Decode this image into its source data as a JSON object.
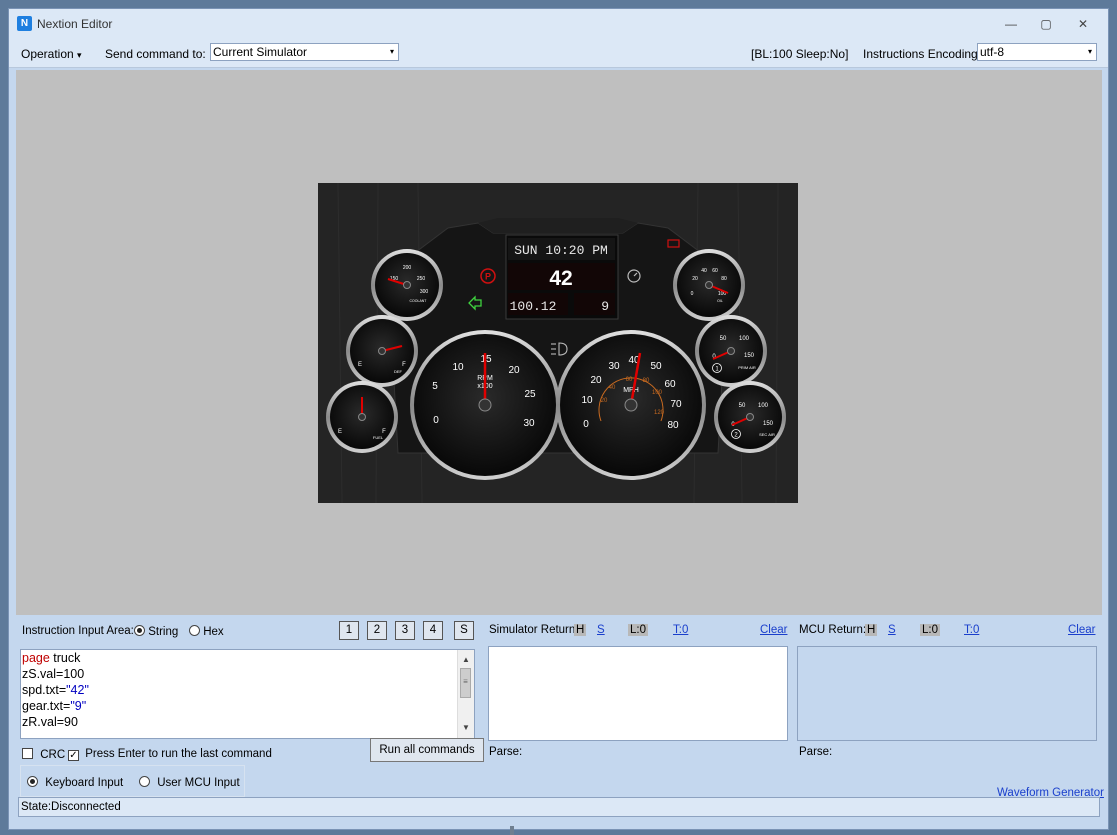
{
  "window": {
    "title": "Nextion Editor",
    "logo_icon": "nextion-logo-icon",
    "minimize_glyph": "—",
    "maximize_glyph": "▢",
    "close_glyph": "✕"
  },
  "toolbar": {
    "operation_label": "Operation",
    "operation_arrow": "▾",
    "send_label": "Send command to:",
    "send_value": "Current Simulator",
    "status_text": "[BL:100  Sleep:No]",
    "encoding_label": "Instructions Encoding:",
    "encoding_value": "utf-8",
    "combo_arrow": "▾"
  },
  "dash": {
    "datetime": "SUN 10:20 PM",
    "speed": "42",
    "odometer": "100.12",
    "gear": "9",
    "rpm_label": "RPM",
    "rpm_multiplier": "x100",
    "mph_label": "MPH",
    "rpm_ticks": [
      "0",
      "5",
      "10",
      "15",
      "20",
      "25",
      "30"
    ],
    "mph_ticks": [
      "0",
      "10",
      "20",
      "30",
      "40",
      "50",
      "60",
      "70",
      "80"
    ],
    "kmh_ticks": [
      "20",
      "40",
      "60",
      "80",
      "100",
      "120"
    ],
    "coolant_ticks": [
      "150",
      "200",
      "250",
      "300"
    ],
    "coolant_label": "COOLANT",
    "oil_ticks": [
      "20",
      "40",
      "60",
      "80",
      "100",
      "0"
    ],
    "oil_label": "OIL",
    "def_letters": [
      "E",
      "F"
    ],
    "def_label": "DEF",
    "prim_ticks": [
      "0",
      "50",
      "100",
      "150"
    ],
    "prim_label": "PRIM AIR",
    "fuel_letters": [
      "E",
      "F"
    ],
    "fuel_label": "FUEL",
    "sec_ticks": [
      "0",
      "50",
      "100",
      "150"
    ],
    "sec_label": "SEC AIR",
    "prim_badge": "1",
    "sec_badge": "2"
  },
  "instruction": {
    "area_label": "Instruction Input Area:",
    "mode_string": "String",
    "mode_hex": "Hex",
    "mode_selected": "String",
    "quick_buttons": [
      "1",
      "2",
      "3",
      "4",
      "S"
    ],
    "lines": [
      {
        "kw": "page",
        "rest": " truck",
        "str": ""
      },
      {
        "kw": "",
        "rest": "zS.val=100",
        "str": ""
      },
      {
        "kw": "",
        "rest": "spd.txt=",
        "str": "\"42\""
      },
      {
        "kw": "",
        "rest": "gear.txt=",
        "str": "\"9\""
      },
      {
        "kw": "",
        "rest": "zR.val=90",
        "str": ""
      }
    ],
    "crc_label": "CRC",
    "crc_checked": false,
    "enter_label": "Press Enter to run the last command",
    "enter_checked": true,
    "run_all": "Run all commands",
    "keyboard_input": "Keyboard Input",
    "mcu_input": "User MCU Input",
    "input_selected": "Keyboard Input"
  },
  "simulator_return": {
    "label": "Simulator Return:",
    "h": "H",
    "s": "S",
    "l": "L:0",
    "t": "T:0",
    "clear": "Clear",
    "parse": "Parse:"
  },
  "mcu_return": {
    "label": "MCU Return:",
    "h": "H",
    "s": "S",
    "l": "L:0",
    "t": "T:0",
    "clear": "Clear",
    "parse": "Parse:"
  },
  "waveform_link": "Waveform Generator",
  "status": "State:Disconnected",
  "colors": {
    "accent_red": "#e00000",
    "string_blue": "#0000c0",
    "link_blue": "#1a3fcc",
    "window_bg": "#c4d7ee"
  }
}
